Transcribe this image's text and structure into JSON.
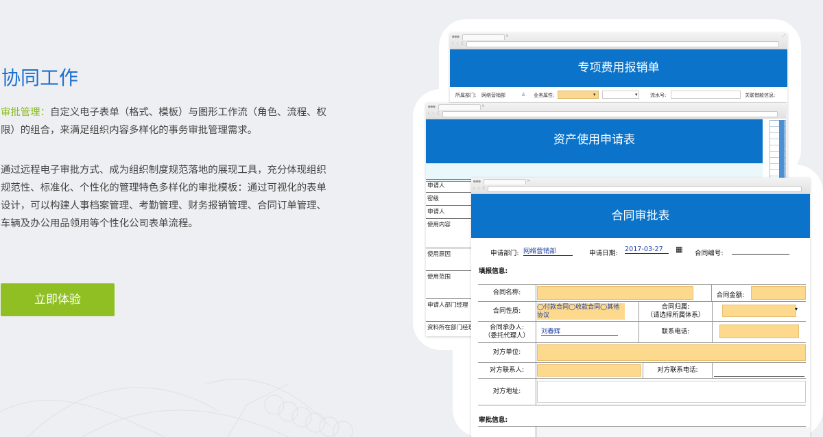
{
  "left": {
    "title": "协同工作",
    "para1_highlight": "审批管理：",
    "para1_text": "自定义电子表单（格式、模板）与图形工作流（角色、流程、权 限）的组合，来满足组织内容多样化的事务审批管理需求。",
    "para2_text": "通过远程电子审批方式、成为组织制度规范落地的展现工具，充分体现组织 规范性、标准化、个性化的管理特色多样化的审批模板：通过可视化的表单 设计，可以构建人事档案管理、考勤管理、财务报销管理、合同订单管理、 车辆及办公用品领用等个性化公司表单流程。",
    "cta_label": "立即体验"
  },
  "win1": {
    "title": "专项费用报销单",
    "field_dept_label": "所属部门:",
    "field_dept_value": "网络营销部",
    "field_biz_label": "业务属性:",
    "field_serial_label": "流水号:",
    "field_related_label": "关联借款信息:"
  },
  "win2": {
    "title": "资产使用申请表",
    "labels": [
      "申请人",
      "密级",
      "申请人",
      "使用内容",
      "使用原因",
      "使用范围",
      "申请人部门经理",
      "资料所在部门经理"
    ]
  },
  "win3": {
    "title": "合同审批表",
    "apply_dept_label": "申请部门:",
    "apply_dept_value": "网络营销部",
    "apply_date_label": "申请日期:",
    "apply_date_value": "2017-03-27",
    "contract_no_label": "合同编号:",
    "section_fill": "填报信息:",
    "contract_name_label": "合同名称:",
    "contract_amount_label": "合同金额:",
    "contract_nature_label": "合同性质:",
    "contract_nature_options": "◯付款合同◯收款合同◯其他协议",
    "contract_owner_label": "合同归属:",
    "contract_owner_hint": "（请选择所属体系）",
    "undertaker_label": "合同承办人:",
    "undertaker_sub": "（委托代理人）",
    "undertaker_value": "刘春辉",
    "phone_label": "联系电话:",
    "counterparty_label": "对方单位:",
    "counterparty_contact_label": "对方联系人:",
    "counterparty_phone_label": "对方联系电话:",
    "counterparty_address_label": "对方地址:",
    "section_approval": "审批信息:"
  }
}
